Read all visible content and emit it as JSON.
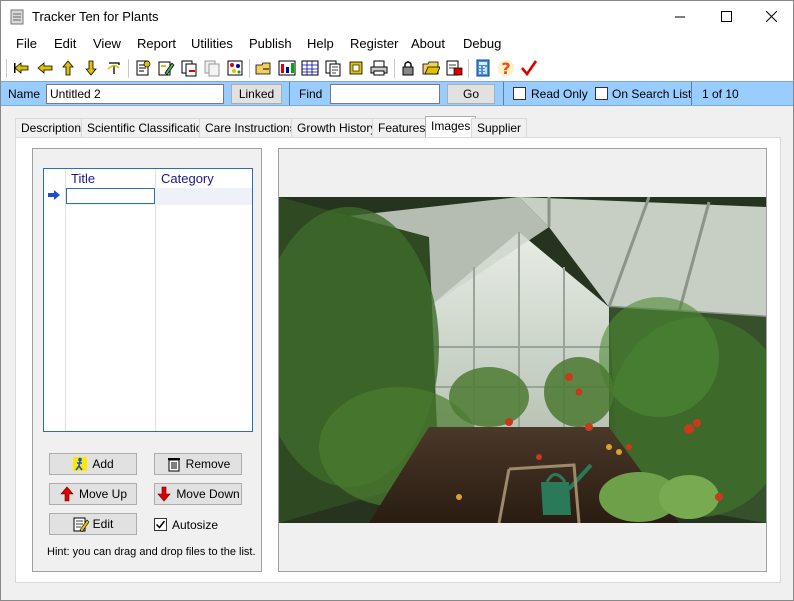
{
  "window": {
    "title": "Tracker Ten for Plants"
  },
  "menu": [
    "File",
    "Edit",
    "View",
    "Report",
    "Utilities",
    "Publish",
    "Help",
    "Register",
    "About",
    "Debug"
  ],
  "toolbar": {
    "icons": [
      "first-record-icon",
      "previous-record-icon",
      "next-record-icon",
      "last-record-icon",
      "undo-icon",
      "new-record-icon",
      "edit-record-icon",
      "copy-record-icon",
      "delete-record-icon",
      "filter-icon",
      "open-icon",
      "table-view-icon",
      "grid-view-icon",
      "duplicate-icon",
      "export-icon",
      "print-icon",
      "lock-icon",
      "folder-icon",
      "save-icon",
      "calculator-icon",
      "help-icon",
      "check-icon"
    ]
  },
  "searchbar": {
    "name_label": "Name",
    "name_value": "Untitled 2",
    "linked_label": "Linked",
    "find_label": "Find",
    "find_value": "",
    "go_label": "Go",
    "read_only_label": "Read Only",
    "search_list_label": "On Search List",
    "record_position": "1 of 10"
  },
  "tabs": [
    "Description",
    "Scientific Classification",
    "Care Instructions",
    "Growth History",
    "Features",
    "Images",
    "Supplier"
  ],
  "active_tab": "Images",
  "images_grid": {
    "columns": [
      "Title",
      "Category"
    ],
    "rows": [
      {
        "title": "",
        "category": ""
      }
    ]
  },
  "buttons": {
    "add": "Add",
    "remove": "Remove",
    "move_up": "Move Up",
    "move_down": "Move Down",
    "edit": "Edit",
    "autosize": "Autosize"
  },
  "autosize_checked": true,
  "hint": "Hint: you can drag and drop files to the list.",
  "colors": {
    "searchbar_bg": "#99ccff",
    "grid_header_text": "#1a1a8c",
    "grid_border": "#2a6fb0"
  }
}
